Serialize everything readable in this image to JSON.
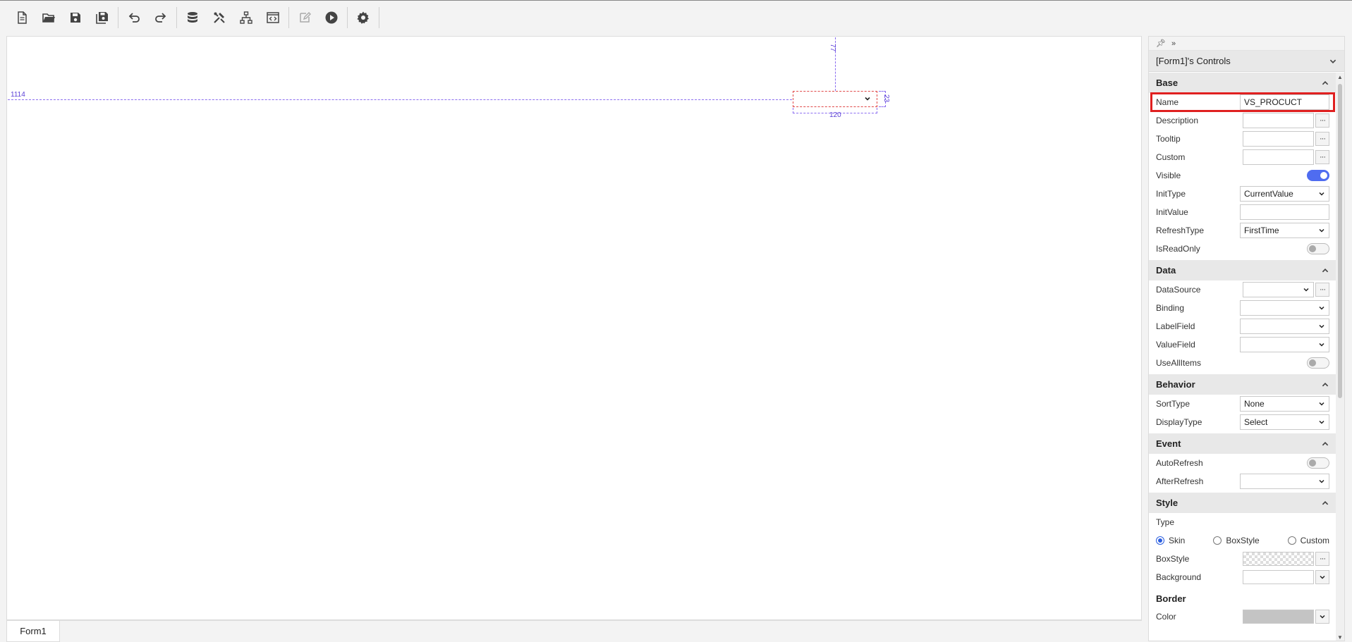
{
  "toolbar": {
    "icons": [
      "new-file-icon",
      "open-folder-icon",
      "save-icon",
      "save-all-icon",
      "undo-icon",
      "redo-icon",
      "database-icon",
      "tools-icon",
      "hierarchy-icon",
      "code-window-icon",
      "edit-icon",
      "play-icon",
      "gear-icon"
    ]
  },
  "canvas": {
    "guide_left": "1114",
    "guide_top": "77",
    "guide_width": "120",
    "guide_height": "23"
  },
  "form_tab": "Form1",
  "panel": {
    "title": "[Form1]'s Controls",
    "sections": {
      "base": "Base",
      "data": "Data",
      "behavior": "Behavior",
      "event": "Event",
      "style": "Style",
      "border": "Border"
    },
    "base": {
      "name_label": "Name",
      "name_value": "VS_PROCUCT",
      "description_label": "Description",
      "tooltip_label": "Tooltip",
      "custom_label": "Custom",
      "visible_label": "Visible",
      "visible_on": true,
      "inittype_label": "InitType",
      "inittype_value": "CurrentValue",
      "initvalue_label": "InitValue",
      "refreshtype_label": "RefreshType",
      "refreshtype_value": "FirstTime",
      "isreadonly_label": "IsReadOnly"
    },
    "data": {
      "datasource_label": "DataSource",
      "binding_label": "Binding",
      "labelfield_label": "LabelField",
      "valuefield_label": "ValueField",
      "useallitems_label": "UseAllItems"
    },
    "behavior": {
      "sorttype_label": "SortType",
      "sorttype_value": "None",
      "displaytype_label": "DisplayType",
      "displaytype_value": "Select"
    },
    "event": {
      "autorefresh_label": "AutoRefresh",
      "afterrefresh_label": "AfterRefresh"
    },
    "style": {
      "type_label": "Type",
      "radio_skin": "Skin",
      "radio_boxstyle": "BoxStyle",
      "radio_custom": "Custom",
      "selected": "Skin",
      "boxstyle_label": "BoxStyle",
      "background_label": "Background"
    },
    "border": {
      "color_label": "Color"
    }
  },
  "colors": {
    "accent": "#4f6cf0",
    "highlight": "#e02020",
    "guide": "#8a6cf0"
  }
}
